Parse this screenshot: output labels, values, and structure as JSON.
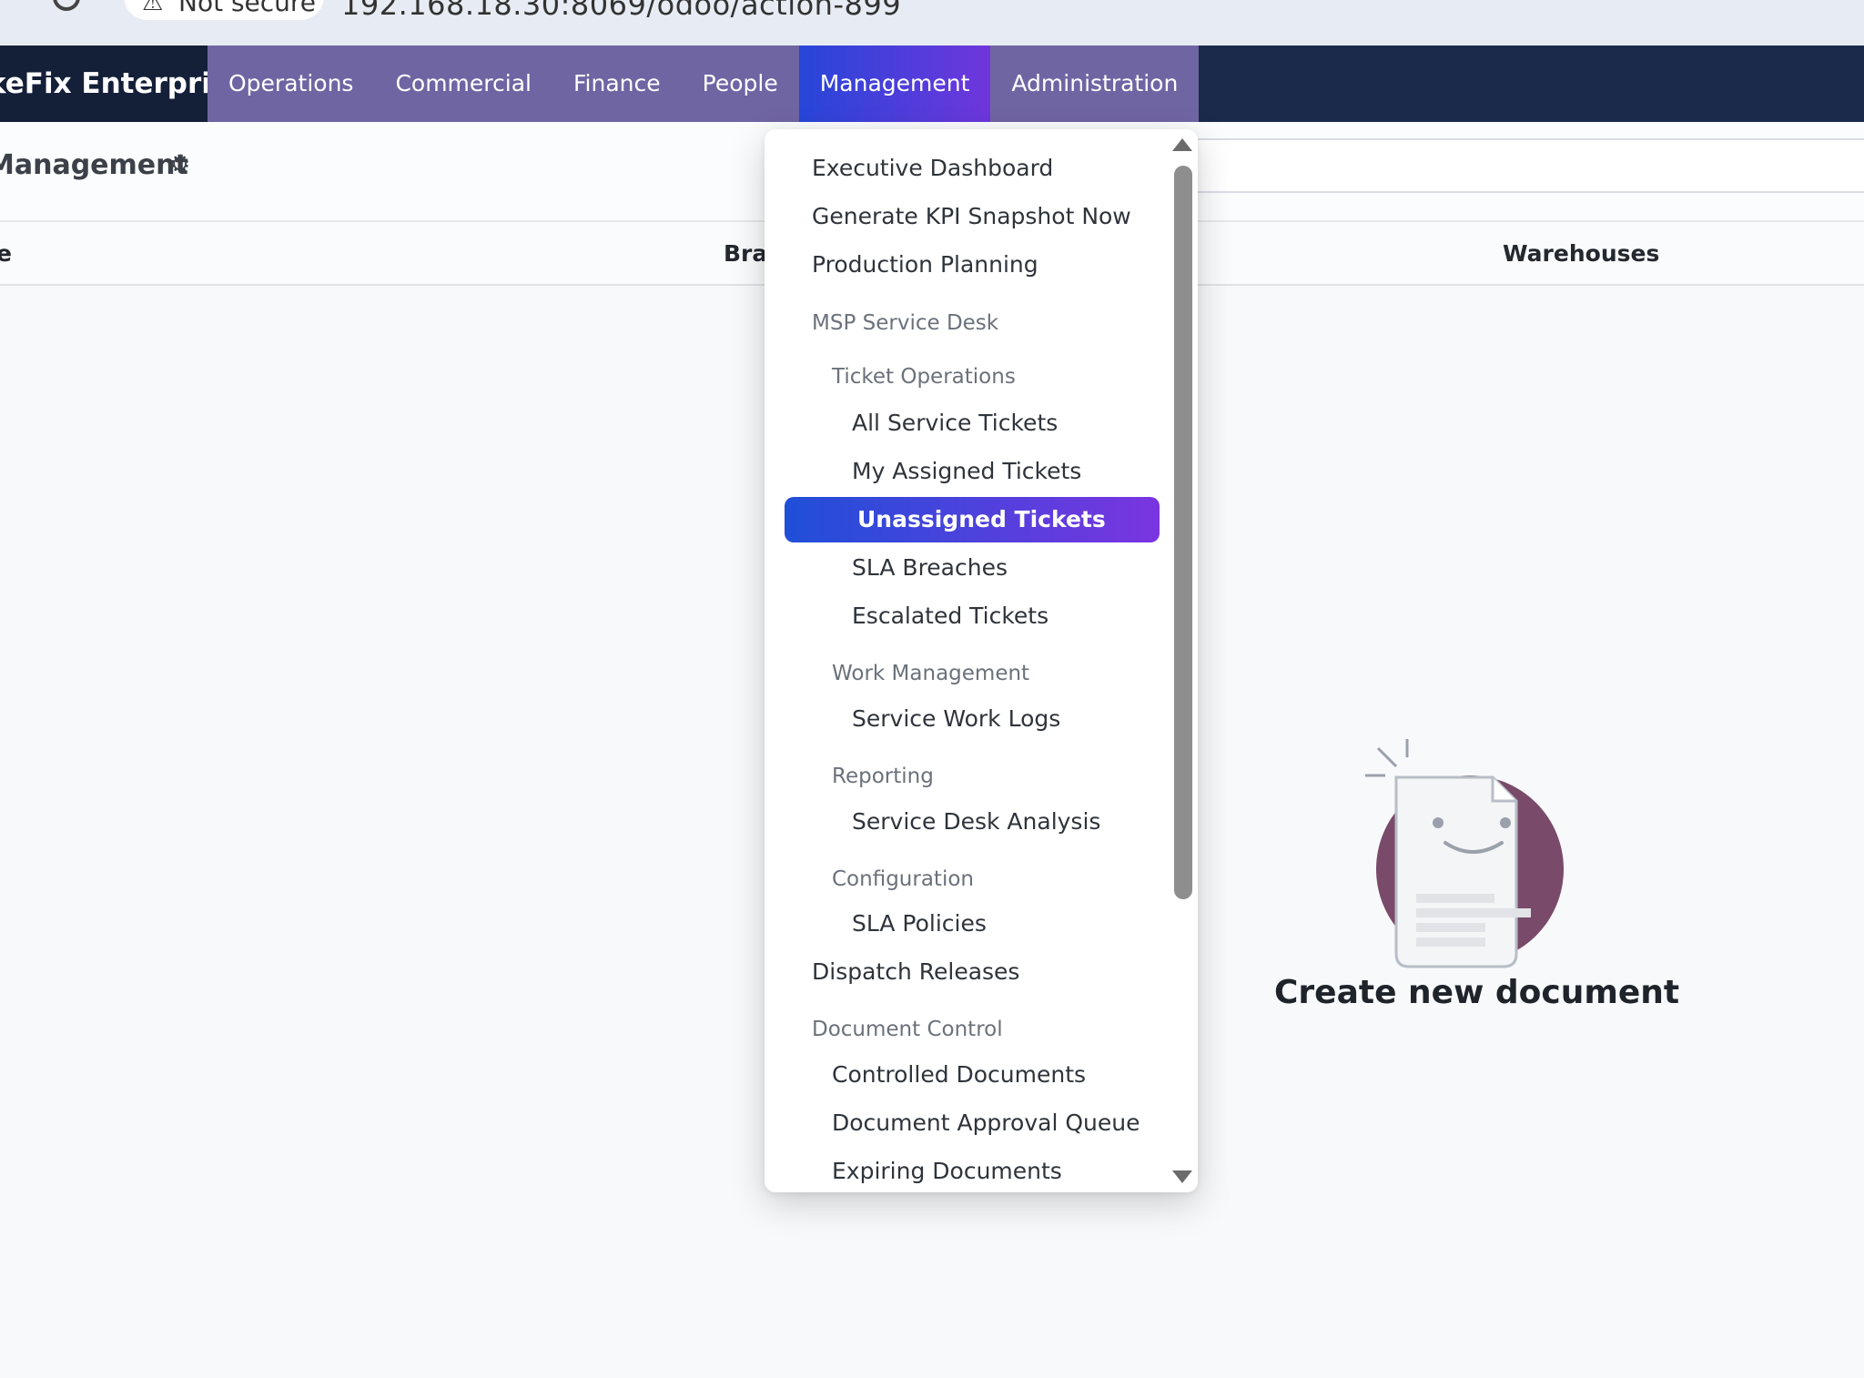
{
  "browser": {
    "security_label": "Not secure",
    "url": "192.168.18.30:8069/odoo/action-899"
  },
  "navbar": {
    "brand": "keFix Enterprise",
    "menus": [
      {
        "label": "Operations"
      },
      {
        "label": "Commercial"
      },
      {
        "label": "Finance"
      },
      {
        "label": "People"
      },
      {
        "label": "Management",
        "active": true
      },
      {
        "label": "Administration"
      }
    ]
  },
  "control_panel": {
    "title": "Management"
  },
  "table": {
    "columns": [
      "e",
      "Bran",
      "Warehouses"
    ]
  },
  "empty_state": {
    "title": "Create new document"
  },
  "dropdown": {
    "executive_dashboard": "Executive Dashboard",
    "generate_kpi": "Generate KPI Snapshot Now",
    "production_planning": "Production Planning",
    "msp_service_desk": "MSP Service Desk",
    "ticket_operations": "Ticket Operations",
    "all_service_tickets": "All Service Tickets",
    "my_assigned_tickets": "My Assigned Tickets",
    "unassigned_tickets": "Unassigned Tickets",
    "sla_breaches": "SLA Breaches",
    "escalated_tickets": "Escalated Tickets",
    "work_management": "Work Management",
    "service_work_logs": "Service Work Logs",
    "reporting": "Reporting",
    "service_desk_analysis": "Service Desk Analysis",
    "configuration": "Configuration",
    "sla_policies": "SLA Policies",
    "dispatch_releases": "Dispatch Releases",
    "document_control": "Document Control",
    "controlled_documents": "Controlled Documents",
    "document_approval_queue": "Document Approval Queue",
    "expiring_documents": "Expiring Documents"
  }
}
